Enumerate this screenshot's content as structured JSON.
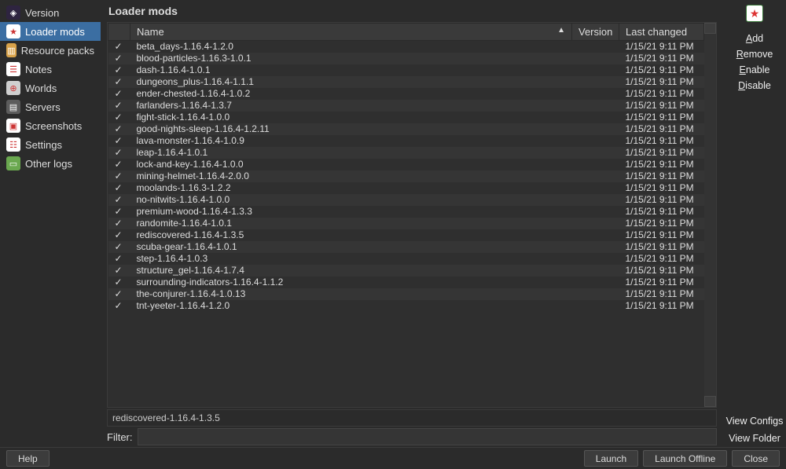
{
  "sidebar": {
    "items": [
      {
        "label": "Version",
        "icon": "cube",
        "bg": "#2e2440"
      },
      {
        "label": "Loader mods",
        "icon": "star",
        "bg": "#ffffff",
        "active": true
      },
      {
        "label": "Resource packs",
        "icon": "box",
        "bg": "#d8a24a"
      },
      {
        "label": "Notes",
        "icon": "note",
        "bg": "#ffffff"
      },
      {
        "label": "Worlds",
        "icon": "globe",
        "bg": "#cfcfcf"
      },
      {
        "label": "Servers",
        "icon": "server",
        "bg": "#5c5c5c"
      },
      {
        "label": "Screenshots",
        "icon": "image",
        "bg": "#ffffff"
      },
      {
        "label": "Settings",
        "icon": "sliders",
        "bg": "#ffffff"
      },
      {
        "label": "Other logs",
        "icon": "book",
        "bg": "#6aa84f"
      }
    ]
  },
  "page_title": "Loader mods",
  "columns": {
    "name": "Name",
    "version": "Version",
    "last_changed": "Last changed"
  },
  "mods": [
    {
      "name": "beta_days-1.16.4-1.2.0",
      "version": "",
      "date": "1/15/21 9:11 PM"
    },
    {
      "name": "blood-particles-1.16.3-1.0.1",
      "version": "",
      "date": "1/15/21 9:11 PM"
    },
    {
      "name": "dash-1.16.4-1.0.1",
      "version": "",
      "date": "1/15/21 9:11 PM"
    },
    {
      "name": "dungeons_plus-1.16.4-1.1.1",
      "version": "",
      "date": "1/15/21 9:11 PM"
    },
    {
      "name": "ender-chested-1.16.4-1.0.2",
      "version": "",
      "date": "1/15/21 9:11 PM"
    },
    {
      "name": "farlanders-1.16.4-1.3.7",
      "version": "",
      "date": "1/15/21 9:11 PM"
    },
    {
      "name": "fight-stick-1.16.4-1.0.0",
      "version": "",
      "date": "1/15/21 9:11 PM"
    },
    {
      "name": "good-nights-sleep-1.16.4-1.2.11",
      "version": "",
      "date": "1/15/21 9:11 PM"
    },
    {
      "name": "lava-monster-1.16.4-1.0.9",
      "version": "",
      "date": "1/15/21 9:11 PM"
    },
    {
      "name": "leap-1.16.4-1.0.1",
      "version": "",
      "date": "1/15/21 9:11 PM"
    },
    {
      "name": "lock-and-key-1.16.4-1.0.0",
      "version": "",
      "date": "1/15/21 9:11 PM"
    },
    {
      "name": "mining-helmet-1.16.4-2.0.0",
      "version": "",
      "date": "1/15/21 9:11 PM"
    },
    {
      "name": "moolands-1.16.3-1.2.2",
      "version": "",
      "date": "1/15/21 9:11 PM"
    },
    {
      "name": "no-nitwits-1.16.4-1.0.0",
      "version": "",
      "date": "1/15/21 9:11 PM"
    },
    {
      "name": "premium-wood-1.16.4-1.3.3",
      "version": "",
      "date": "1/15/21 9:11 PM"
    },
    {
      "name": "randomite-1.16.4-1.0.1",
      "version": "",
      "date": "1/15/21 9:11 PM"
    },
    {
      "name": "rediscovered-1.16.4-1.3.5",
      "version": "",
      "date": "1/15/21 9:11 PM"
    },
    {
      "name": "scuba-gear-1.16.4-1.0.1",
      "version": "",
      "date": "1/15/21 9:11 PM"
    },
    {
      "name": "step-1.16.4-1.0.3",
      "version": "",
      "date": "1/15/21 9:11 PM"
    },
    {
      "name": "structure_gel-1.16.4-1.7.4",
      "version": "",
      "date": "1/15/21 9:11 PM"
    },
    {
      "name": "surrounding-indicators-1.16.4-1.1.2",
      "version": "",
      "date": "1/15/21 9:11 PM"
    },
    {
      "name": "the-conjurer-1.16.4-1.0.13",
      "version": "",
      "date": "1/15/21 9:11 PM"
    },
    {
      "name": "tnt-yeeter-1.16.4-1.2.0",
      "version": "",
      "date": "1/15/21 9:11 PM"
    }
  ],
  "status_text": "rediscovered-1.16.4-1.3.5",
  "filter_label": "Filter:",
  "filter_value": "",
  "actions": {
    "top": [
      "Add",
      "Remove",
      "Enable",
      "Disable"
    ],
    "bottom": [
      "View Configs",
      "View Folder"
    ]
  },
  "bottom": {
    "help": "Help",
    "launch": "Launch",
    "launch_offline": "Launch Offline",
    "close": "Close"
  }
}
